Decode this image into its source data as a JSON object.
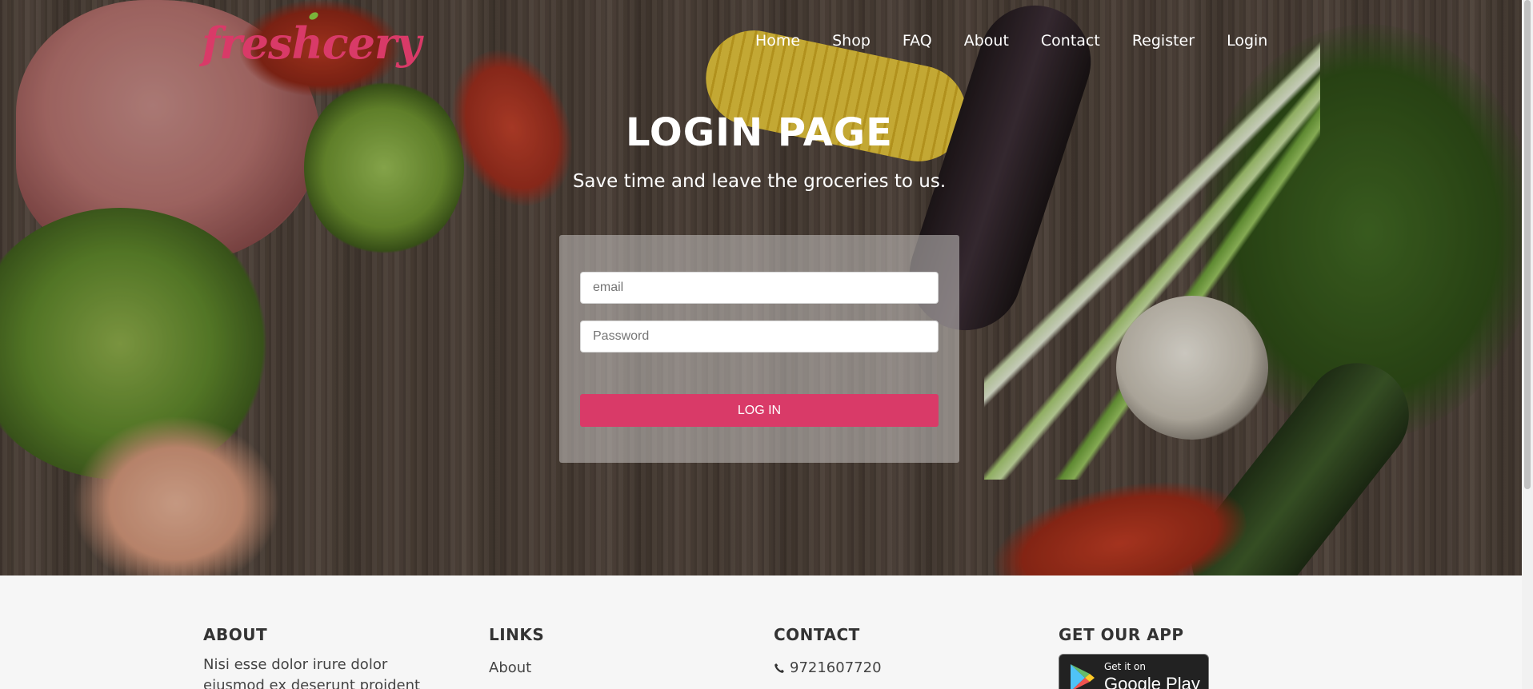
{
  "brand": {
    "name": "freshcery",
    "color": "#d93a68"
  },
  "nav": {
    "items": [
      {
        "label": "Home"
      },
      {
        "label": "Shop"
      },
      {
        "label": "FAQ"
      },
      {
        "label": "About"
      },
      {
        "label": "Contact"
      },
      {
        "label": "Register"
      },
      {
        "label": "Login"
      }
    ]
  },
  "hero": {
    "title": "LOGIN PAGE",
    "subtitle": "Save time and leave the groceries to us."
  },
  "login_form": {
    "email_placeholder": "email",
    "email_value": "",
    "password_placeholder": "Password",
    "password_value": "",
    "submit_label": "LOG IN",
    "accent_color": "#d93a68"
  },
  "footer": {
    "about": {
      "heading": "ABOUT",
      "text": "Nisi esse dolor irure dolor eiusmod ex deserunt proident cillum eu qui"
    },
    "links": {
      "heading": "LINKS",
      "items": [
        {
          "label": "About"
        }
      ]
    },
    "contact": {
      "heading": "CONTACT",
      "phone": "9721607720",
      "phone_icon": "phone-icon"
    },
    "app": {
      "heading": "GET OUR APP",
      "badge_small": "Get it on",
      "badge_big": "Google Play",
      "badge_icon": "google-play-icon"
    }
  }
}
